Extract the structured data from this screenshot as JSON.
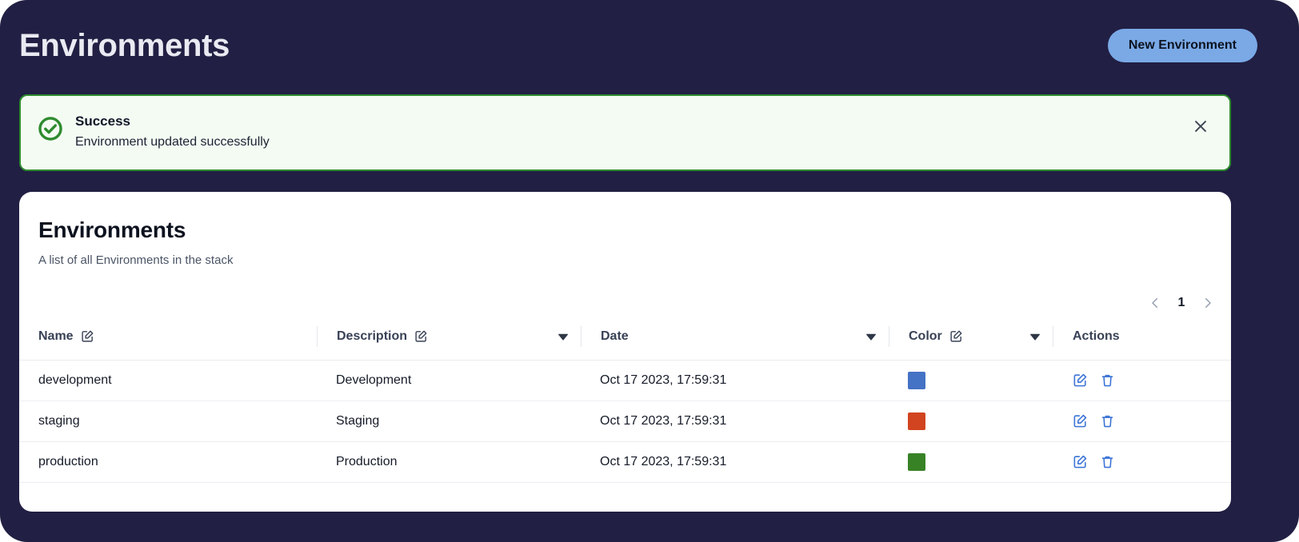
{
  "header": {
    "title": "Environments",
    "new_button_label": "New Environment"
  },
  "alert": {
    "type": "success",
    "icon": "check-circle-icon",
    "title": "Success",
    "message": "Environment updated successfully",
    "close_icon": "close-icon",
    "background_color": "#f4fbf3",
    "border_color": "#2e8b2e"
  },
  "card": {
    "title": "Environments",
    "subtitle": "A list of all Environments in the stack"
  },
  "pagination": {
    "prev_icon": "chevron-left-icon",
    "next_icon": "chevron-right-icon",
    "current_page": "1"
  },
  "table": {
    "columns": [
      {
        "label": "Name",
        "editable": true,
        "sortable": false
      },
      {
        "label": "Description",
        "editable": true,
        "sortable": true
      },
      {
        "label": "Date",
        "editable": false,
        "sortable": true
      },
      {
        "label": "Color",
        "editable": true,
        "sortable": true
      },
      {
        "label": "Actions",
        "editable": false,
        "sortable": false
      }
    ],
    "rows": [
      {
        "name": "development",
        "description": "Development",
        "date": "Oct 17 2023, 17:59:31",
        "color": "#4472c4"
      },
      {
        "name": "staging",
        "description": "Staging",
        "date": "Oct 17 2023, 17:59:31",
        "color": "#d1441f"
      },
      {
        "name": "production",
        "description": "Production",
        "date": "Oct 17 2023, 17:59:31",
        "color": "#388226"
      }
    ],
    "row_actions": [
      {
        "icon": "edit-icon",
        "name": "edit-row-button"
      },
      {
        "icon": "trash-icon",
        "name": "delete-row-button"
      }
    ]
  },
  "colors": {
    "page_background": "#211f43",
    "accent_button": "#7aa9e6",
    "action_icon": "#3b73d6"
  }
}
